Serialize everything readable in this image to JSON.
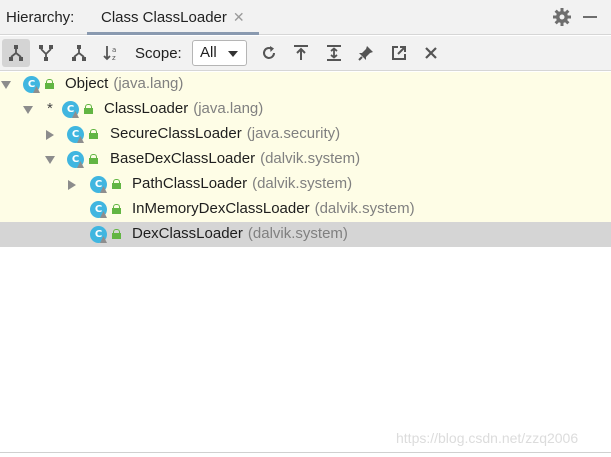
{
  "header": {
    "label": "Hierarchy:",
    "tab_title": "Class ClassLoader",
    "tab_close": "✕",
    "gear_icon": "gear-icon",
    "minimize_icon": "minus-icon"
  },
  "toolbar": {
    "buttons": [
      {
        "name": "type-hierarchy-icon",
        "active": true
      },
      {
        "name": "supertypes-hierarchy-icon",
        "active": false
      },
      {
        "name": "subtypes-hierarchy-icon",
        "active": false
      },
      {
        "name": "sort-alphabetically-icon",
        "active": false
      }
    ],
    "scope_label": "Scope:",
    "scope_value": "All",
    "actions": [
      "refresh-icon",
      "export-icon",
      "expand-all-icon",
      "pin-icon",
      "open-in-new-window-icon",
      "close-icon"
    ]
  },
  "tree": {
    "rows": [
      {
        "name": "Object",
        "pkg": "(java.lang)",
        "expander": "down",
        "star": false,
        "selected": false
      },
      {
        "name": "ClassLoader",
        "pkg": "(java.lang)",
        "expander": "down",
        "star": true,
        "selected": false
      },
      {
        "name": "SecureClassLoader",
        "pkg": "(java.security)",
        "expander": "right",
        "star": false,
        "selected": false
      },
      {
        "name": "BaseDexClassLoader",
        "pkg": "(dalvik.system)",
        "expander": "down",
        "star": false,
        "selected": false
      },
      {
        "name": "PathClassLoader",
        "pkg": "(dalvik.system)",
        "expander": "right",
        "star": false,
        "selected": false
      },
      {
        "name": "InMemoryDexClassLoader",
        "pkg": "(dalvik.system)",
        "expander": "none",
        "star": false,
        "selected": false
      },
      {
        "name": "DexClassLoader",
        "pkg": "(dalvik.system)",
        "expander": "none",
        "star": false,
        "selected": true
      }
    ],
    "class_icon_letter": "C",
    "colors": {
      "tree_bg": "#fefde6",
      "selected_bg": "#d5d5d5",
      "class_icon": "#40b6e0",
      "lock": "#62b543"
    }
  },
  "watermark": "https://blog.csdn.net/zzq2006"
}
